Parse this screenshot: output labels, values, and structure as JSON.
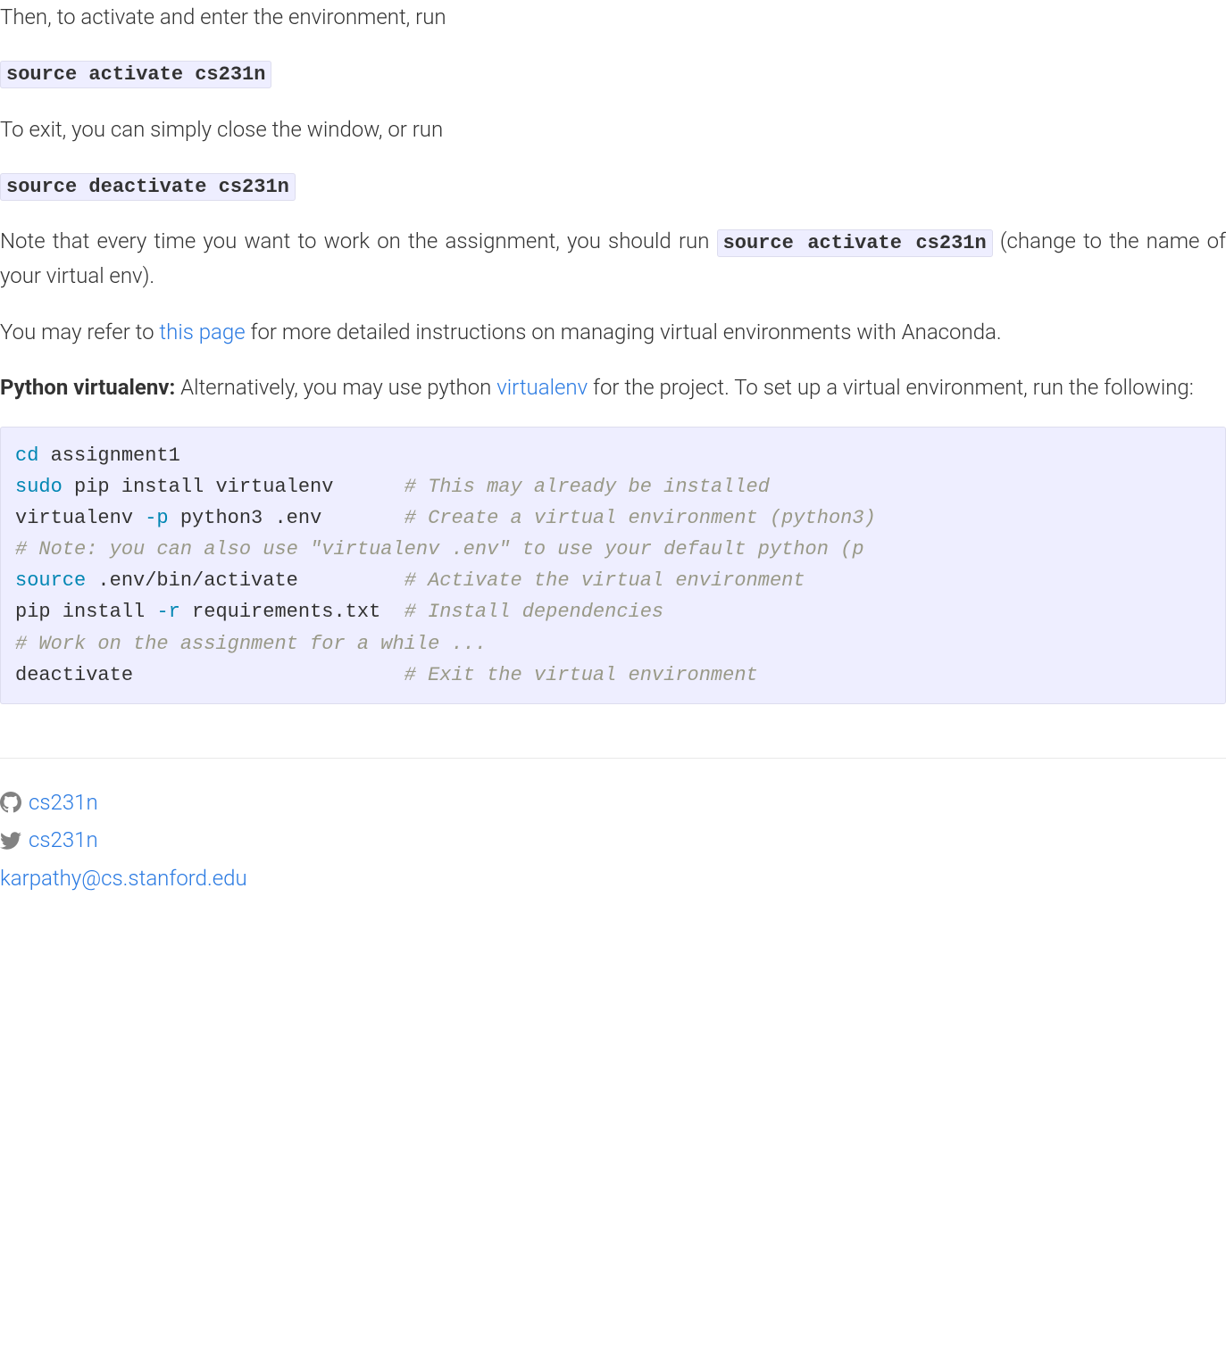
{
  "paragraphs": {
    "p1": "Then, to activate and enter the environment, run",
    "code1": "source activate cs231n",
    "p2": "To exit, you can simply close the window, or run",
    "code2": "source deactivate cs231n",
    "p3_before": "Note that every time you want to work on the assignment, you should run ",
    "p3_code": "source activate cs231n",
    "p3_after": " (change to the name of your virtual env).",
    "p4_before": "You may refer to ",
    "p4_link": "this page",
    "p4_after": " for more detailed instructions on managing virtual environments with Anaconda.",
    "p5_strong": "Python virtualenv:",
    "p5_before": " Alternatively, you may use python ",
    "p5_link": "virtualenv",
    "p5_after": " for the project. To set up a virtual environment, run the following:"
  },
  "code_block": {
    "l1_kw": "cd ",
    "l1_rest": "assignment1",
    "l2_kw": "sudo ",
    "l2_rest": "pip install virtualenv      ",
    "l2_cmt": "# This may already be installed",
    "l3_a": "virtualenv ",
    "l3_flag": "-p",
    "l3_b": " python3 .env       ",
    "l3_cmt": "# Create a virtual environment (python3)",
    "l4_cmt": "# Note: you can also use \"virtualenv .env\" to use your default python (p",
    "l5_kw": "source ",
    "l5_rest": ".env/bin/activate         ",
    "l5_cmt": "# Activate the virtual environment",
    "l6_a": "pip install ",
    "l6_flag": "-r",
    "l6_b": " requirements.txt  ",
    "l6_cmt": "# Install dependencies",
    "l7_cmt": "# Work on the assignment for a while ...",
    "l8_a": "deactivate                       ",
    "l8_cmt": "# Exit the virtual environment"
  },
  "footer": {
    "github": "cs231n",
    "twitter": "cs231n",
    "email": "karpathy@cs.stanford.edu"
  }
}
